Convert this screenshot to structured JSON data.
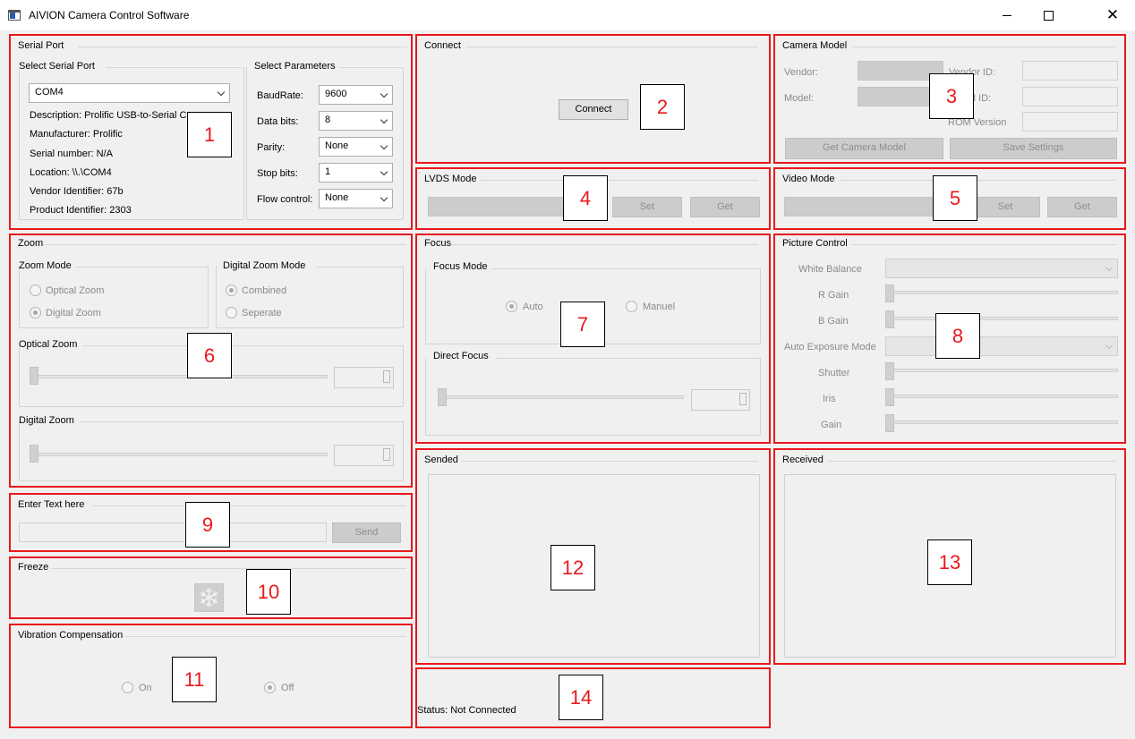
{
  "window": {
    "title": "AIVION Camera Control Software",
    "minimize": "",
    "maximize": "",
    "close": "✕"
  },
  "serial_port": {
    "title": "Serial Port",
    "select_title": "Select Serial Port",
    "port_value": "COM4",
    "description": "Description: Prolific USB-to-Serial C",
    "manufacturer": "Manufacturer: Prolific",
    "serial_number": "Serial number: N/A",
    "location": "Location: \\\\.\\COM4",
    "vendor_id": "Vendor Identifier: 67b",
    "product_id": "Product Identifier: 2303",
    "params_title": "Select Parameters",
    "params": [
      {
        "label": "BaudRate:",
        "value": "9600"
      },
      {
        "label": "Data bits:",
        "value": "8"
      },
      {
        "label": "Parity:",
        "value": "None"
      },
      {
        "label": "Stop bits:",
        "value": "1"
      },
      {
        "label": "Flow control:",
        "value": "None"
      }
    ]
  },
  "connect": {
    "title": "Connect",
    "button": "Connect"
  },
  "camera_model": {
    "title": "Camera Model",
    "vendor_label": "Vendor:",
    "model_label": "Model:",
    "vendor_id_label": "Vendor ID:",
    "model_id_label": "Model ID:",
    "rom_label": "ROM Version",
    "get_button": "Get Camera Model",
    "save_button": "Save Settings"
  },
  "lvds": {
    "title": "LVDS Mode",
    "set": "Set",
    "get": "Get"
  },
  "video": {
    "title": "Video Mode",
    "set": "Set",
    "get": "Get"
  },
  "zoom": {
    "title": "Zoom",
    "mode_title": "Zoom Mode",
    "optical_zoom_radio": "Optical Zoom",
    "digital_zoom_radio": "Digital Zoom",
    "digital_mode_title": "Digital Zoom Mode",
    "combined": "Combined",
    "seperate": "Seperate",
    "optical_group": "Optical Zoom",
    "digital_group": "Digital Zoom"
  },
  "focus": {
    "title": "Focus",
    "mode_title": "Focus Mode",
    "auto": "Auto",
    "manual": "Manuel",
    "direct_title": "Direct Focus"
  },
  "picture": {
    "title": "Picture Control",
    "white_balance": "White Balance",
    "r_gain": "R Gain",
    "b_gain": "B Gain",
    "ae_mode": "Auto Exposure Mode",
    "shutter": "Shutter",
    "iris": "Iris",
    "gain": "Gain"
  },
  "text_entry": {
    "title": "Enter Text here",
    "send": "Send"
  },
  "freeze": {
    "title": "Freeze",
    "icon": "snowflake-icon"
  },
  "vibration": {
    "title": "Vibration Compensation",
    "on": "On",
    "off": "Off"
  },
  "sended": {
    "title": "Sended"
  },
  "received": {
    "title": "Received"
  },
  "status": {
    "text": "Status: Not Connected"
  },
  "annotations": [
    "1",
    "2",
    "3",
    "4",
    "5",
    "6",
    "7",
    "8",
    "9",
    "10",
    "11",
    "12",
    "13",
    "14"
  ],
  "colors": {
    "annotation_red": "#e8191c",
    "background": "#f0f0f0"
  }
}
